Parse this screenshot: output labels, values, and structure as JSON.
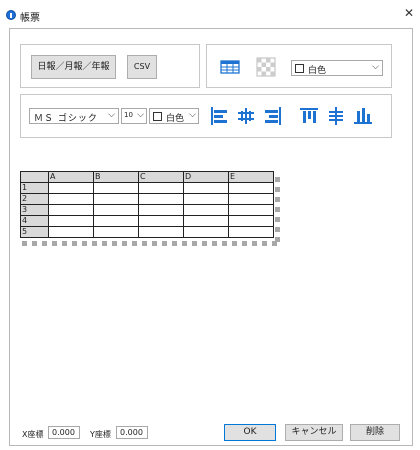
{
  "window": {
    "title": "帳票"
  },
  "toolbar1": {
    "report_label": "日報／月報／年報",
    "csv_label": "CSV",
    "bg_color_value": "白色"
  },
  "toolbar2": {
    "font_value": "ＭＳ ゴシック",
    "size_value": "10",
    "text_color_value": "白色"
  },
  "grid": {
    "columns": [
      "A",
      "B",
      "C",
      "D",
      "E"
    ],
    "rows": [
      "1",
      "2",
      "3",
      "4",
      "5"
    ]
  },
  "coords": {
    "x_label": "X座標",
    "x_value": "0.000",
    "y_label": "Y座標",
    "y_value": "0.000"
  },
  "buttons": {
    "ok": "OK",
    "cancel": "キャンセル",
    "delete": "削除"
  },
  "colors": {
    "accent": "#1d6fd6",
    "icon_blue": "#1e73d2"
  }
}
